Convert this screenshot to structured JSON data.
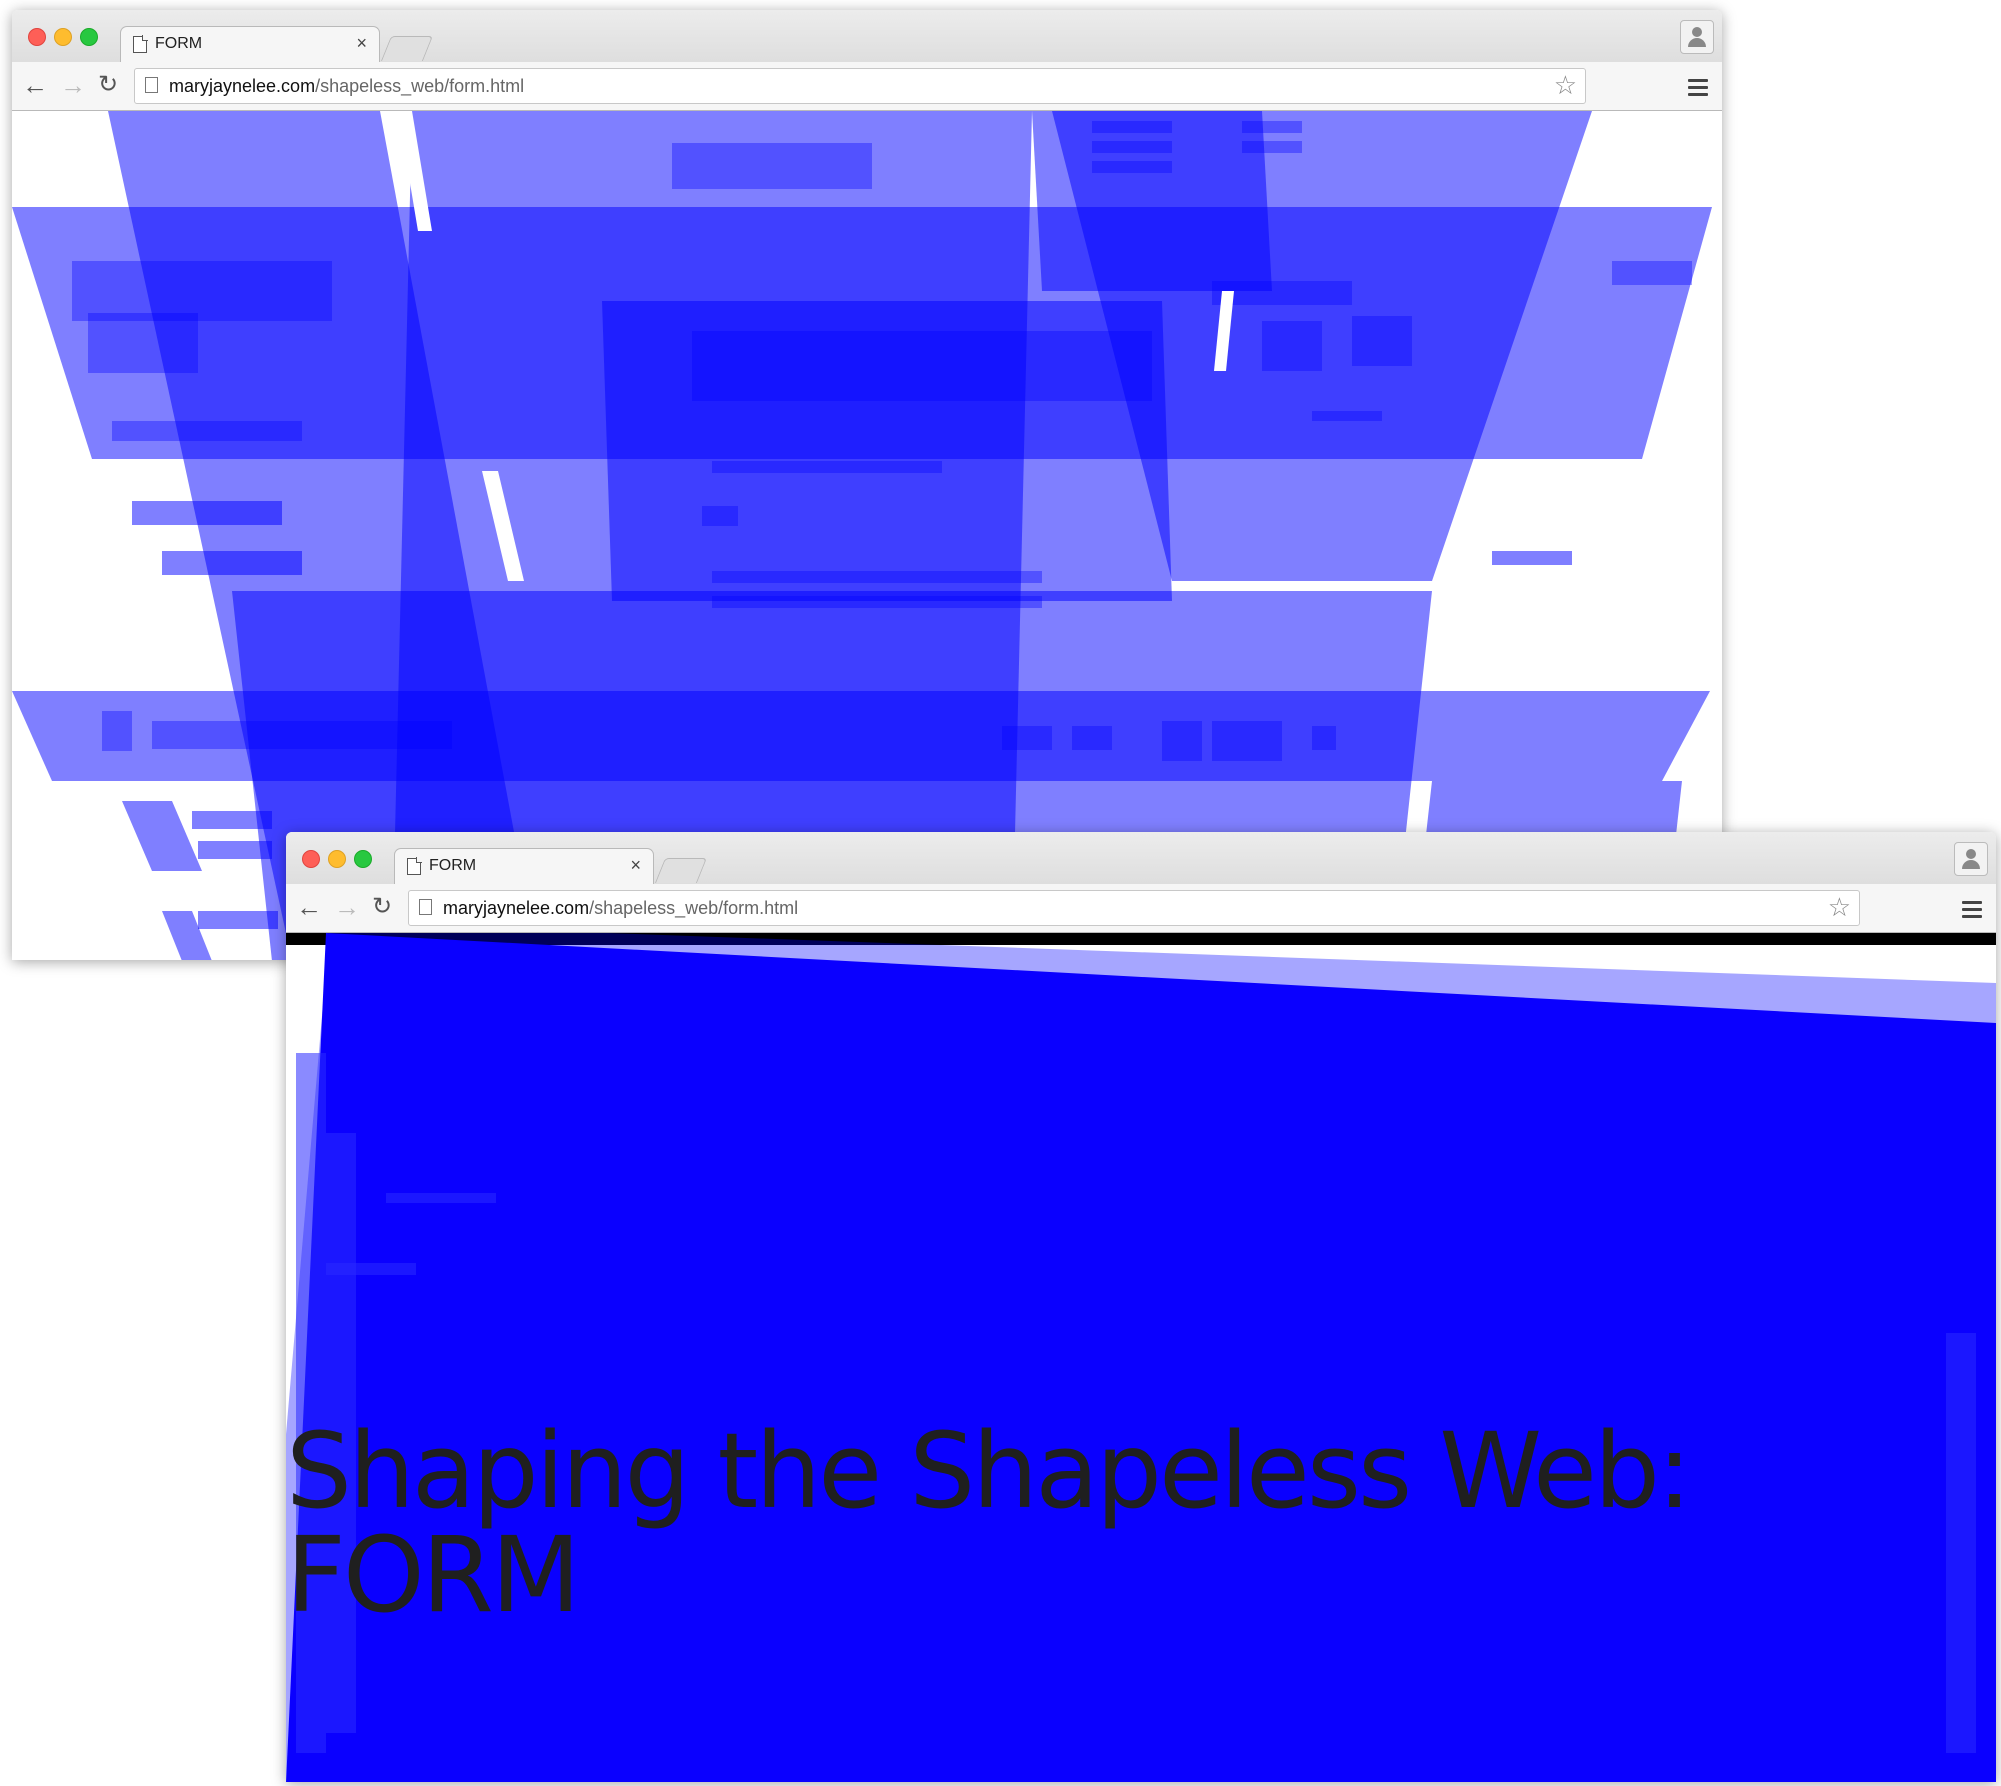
{
  "colors": {
    "accent": "#0000ff",
    "page_bg": "#ffffff",
    "headline": "#1f1f1f"
  },
  "windows": [
    {
      "id": "back",
      "tab": {
        "title": "FORM",
        "close": "×"
      },
      "toolbar": {
        "back_icon": "arrow-left-icon",
        "forward_icon": "arrow-right-icon",
        "reload_icon": "reload-icon",
        "url_host": "maryjaynelee.com",
        "url_path": "/shapeless_web/form.html",
        "bookmark_icon": "star-icon",
        "menu_icon": "hamburger-menu-icon"
      }
    },
    {
      "id": "front",
      "tab": {
        "title": "FORM",
        "close": "×"
      },
      "toolbar": {
        "back_icon": "arrow-left-icon",
        "forward_icon": "arrow-right-icon",
        "reload_icon": "reload-icon",
        "url_host": "maryjaynelee.com",
        "url_path": "/shapeless_web/form.html",
        "bookmark_icon": "star-icon",
        "menu_icon": "hamburger-menu-icon"
      },
      "headline": {
        "line1": "Shaping the Shapeless Web:",
        "line2": "FORM"
      }
    }
  ]
}
